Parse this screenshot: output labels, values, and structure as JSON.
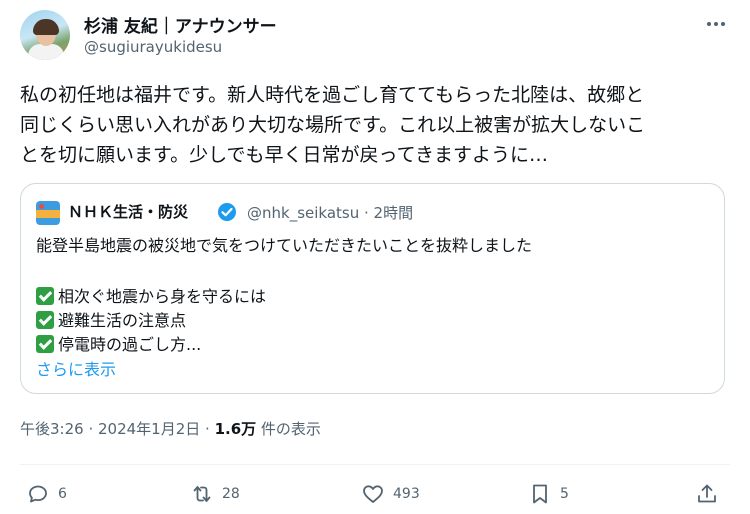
{
  "author": {
    "display_name": "杉浦 友紀｜アナウンサー",
    "handle": "@sugiurayukidesu"
  },
  "tweet": {
    "text": "私の初任地は福井です。新人時代を過ごし育ててもらった北陸は、故郷と\n同じくらい思い入れがあり大切な場所です。これ以上被害が拡大しないこ\nとを切に願います。少しでも早く日常が戻ってきますように…"
  },
  "quote": {
    "name": "ＮＨＫ生活・防災",
    "handle_time": "@nhk_seikatsu · 2時間",
    "line1": "能登半島地震の被災地で気をつけていただきたいことを抜粋しました",
    "items": [
      "相次ぐ地震から身を守るには",
      "避難生活の注意点",
      "停電時の過ごし方..."
    ],
    "show_more": "さらに表示"
  },
  "meta": {
    "time": "午後3:26 · 2024年1月2日 · ",
    "views": "1.6万",
    "views_label": " 件の表示"
  },
  "actions": {
    "reply": "6",
    "retweet": "28",
    "like": "493",
    "bookmark": "5"
  },
  "icons": {
    "more": "more-icon",
    "verified": "verified-badge-icon",
    "reply": "reply-icon",
    "retweet": "retweet-icon",
    "like": "heart-icon",
    "bookmark": "bookmark-icon",
    "share": "share-icon"
  },
  "colors": {
    "link": "#1d9bf0",
    "secondary_text": "#536471",
    "border": "#cfd9de"
  }
}
